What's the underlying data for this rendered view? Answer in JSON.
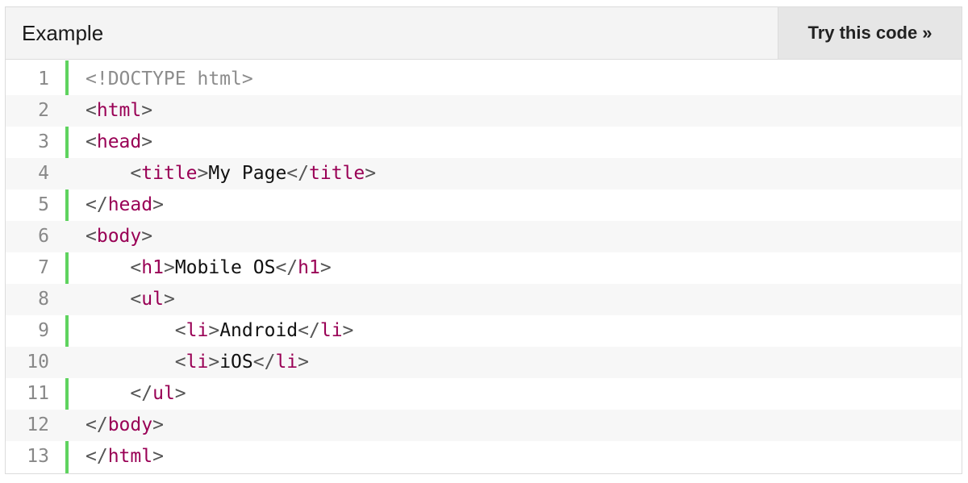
{
  "header": {
    "title": "Example",
    "try_button_label": "Try this code »"
  },
  "code": {
    "lines": [
      {
        "num": "1",
        "indent": "",
        "parts": [
          {
            "k": "doc",
            "t": "<!DOCTYPE html>"
          }
        ]
      },
      {
        "num": "2",
        "indent": "",
        "parts": [
          {
            "k": "br",
            "t": "<"
          },
          {
            "k": "tag",
            "t": "html"
          },
          {
            "k": "br",
            "t": ">"
          }
        ]
      },
      {
        "num": "3",
        "indent": "",
        "parts": [
          {
            "k": "br",
            "t": "<"
          },
          {
            "k": "tag",
            "t": "head"
          },
          {
            "k": "br",
            "t": ">"
          }
        ]
      },
      {
        "num": "4",
        "indent": "    ",
        "parts": [
          {
            "k": "br",
            "t": "<"
          },
          {
            "k": "tag",
            "t": "title"
          },
          {
            "k": "br",
            "t": ">"
          },
          {
            "k": "txt",
            "t": "My Page"
          },
          {
            "k": "br",
            "t": "</"
          },
          {
            "k": "tag",
            "t": "title"
          },
          {
            "k": "br",
            "t": ">"
          }
        ]
      },
      {
        "num": "5",
        "indent": "",
        "parts": [
          {
            "k": "br",
            "t": "</"
          },
          {
            "k": "tag",
            "t": "head"
          },
          {
            "k": "br",
            "t": ">"
          }
        ]
      },
      {
        "num": "6",
        "indent": "",
        "parts": [
          {
            "k": "br",
            "t": "<"
          },
          {
            "k": "tag",
            "t": "body"
          },
          {
            "k": "br",
            "t": ">"
          }
        ]
      },
      {
        "num": "7",
        "indent": "    ",
        "parts": [
          {
            "k": "br",
            "t": "<"
          },
          {
            "k": "tag",
            "t": "h1"
          },
          {
            "k": "br",
            "t": ">"
          },
          {
            "k": "txt",
            "t": "Mobile OS"
          },
          {
            "k": "br",
            "t": "</"
          },
          {
            "k": "tag",
            "t": "h1"
          },
          {
            "k": "br",
            "t": ">"
          }
        ]
      },
      {
        "num": "8",
        "indent": "    ",
        "parts": [
          {
            "k": "br",
            "t": "<"
          },
          {
            "k": "tag",
            "t": "ul"
          },
          {
            "k": "br",
            "t": ">"
          }
        ]
      },
      {
        "num": "9",
        "indent": "        ",
        "parts": [
          {
            "k": "br",
            "t": "<"
          },
          {
            "k": "tag",
            "t": "li"
          },
          {
            "k": "br",
            "t": ">"
          },
          {
            "k": "txt",
            "t": "Android"
          },
          {
            "k": "br",
            "t": "</"
          },
          {
            "k": "tag",
            "t": "li"
          },
          {
            "k": "br",
            "t": ">"
          }
        ]
      },
      {
        "num": "10",
        "indent": "        ",
        "parts": [
          {
            "k": "br",
            "t": "<"
          },
          {
            "k": "tag",
            "t": "li"
          },
          {
            "k": "br",
            "t": ">"
          },
          {
            "k": "txt",
            "t": "iOS"
          },
          {
            "k": "br",
            "t": "</"
          },
          {
            "k": "tag",
            "t": "li"
          },
          {
            "k": "br",
            "t": ">"
          }
        ]
      },
      {
        "num": "11",
        "indent": "    ",
        "parts": [
          {
            "k": "br",
            "t": "</"
          },
          {
            "k": "tag",
            "t": "ul"
          },
          {
            "k": "br",
            "t": ">"
          }
        ]
      },
      {
        "num": "12",
        "indent": "",
        "parts": [
          {
            "k": "br",
            "t": "</"
          },
          {
            "k": "tag",
            "t": "body"
          },
          {
            "k": "br",
            "t": ">"
          }
        ]
      },
      {
        "num": "13",
        "indent": "",
        "parts": [
          {
            "k": "br",
            "t": "</"
          },
          {
            "k": "tag",
            "t": "html"
          },
          {
            "k": "br",
            "t": ">"
          }
        ]
      }
    ]
  },
  "colors": {
    "gutter_accent": "#5fd35f",
    "tag": "#990055",
    "doctype": "#8c8c8c"
  }
}
